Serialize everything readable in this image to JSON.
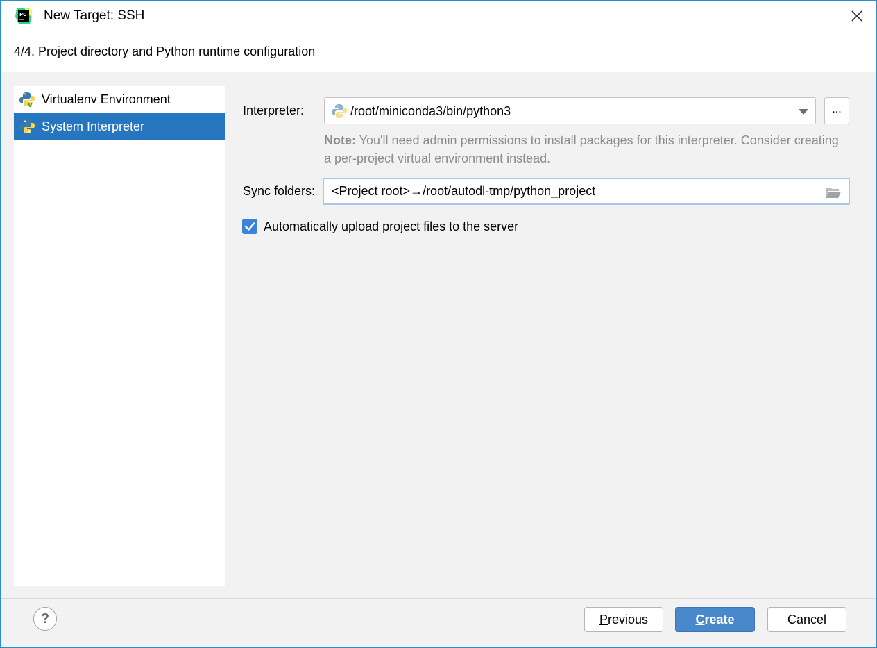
{
  "window": {
    "title": "New Target: SSH",
    "step_title": "4/4. Project directory and Python runtime configuration"
  },
  "sidebar": {
    "items": [
      {
        "label": "Virtualenv Environment",
        "icon": "python-virtualenv-icon",
        "selected": false
      },
      {
        "label": "System Interpreter",
        "icon": "python-icon",
        "selected": true
      }
    ]
  },
  "form": {
    "interpreter_label": "Interpreter:",
    "interpreter_value": "/root/miniconda3/bin/python3",
    "browse_label": "...",
    "note_bold": "Note:",
    "note_text": " You'll need admin permissions to install packages for this interpreter. Consider creating a per-project virtual environment instead.",
    "sync_label": "Sync folders:",
    "sync_value": "<Project root>→/root/autodl-tmp/python_project",
    "auto_upload_label": "Automatically upload project files to the server",
    "auto_upload_checked": true
  },
  "footer": {
    "help_label": "?",
    "previous_prefix": "",
    "previous_mnemonic": "P",
    "previous_rest": "revious",
    "create_mnemonic": "C",
    "create_rest": "reate",
    "cancel_label": "Cancel"
  },
  "colors": {
    "selection": "#2675bf",
    "primary_button": "#4a88cc",
    "checkbox": "#3b82d8",
    "window_border": "#2b8ec9"
  }
}
